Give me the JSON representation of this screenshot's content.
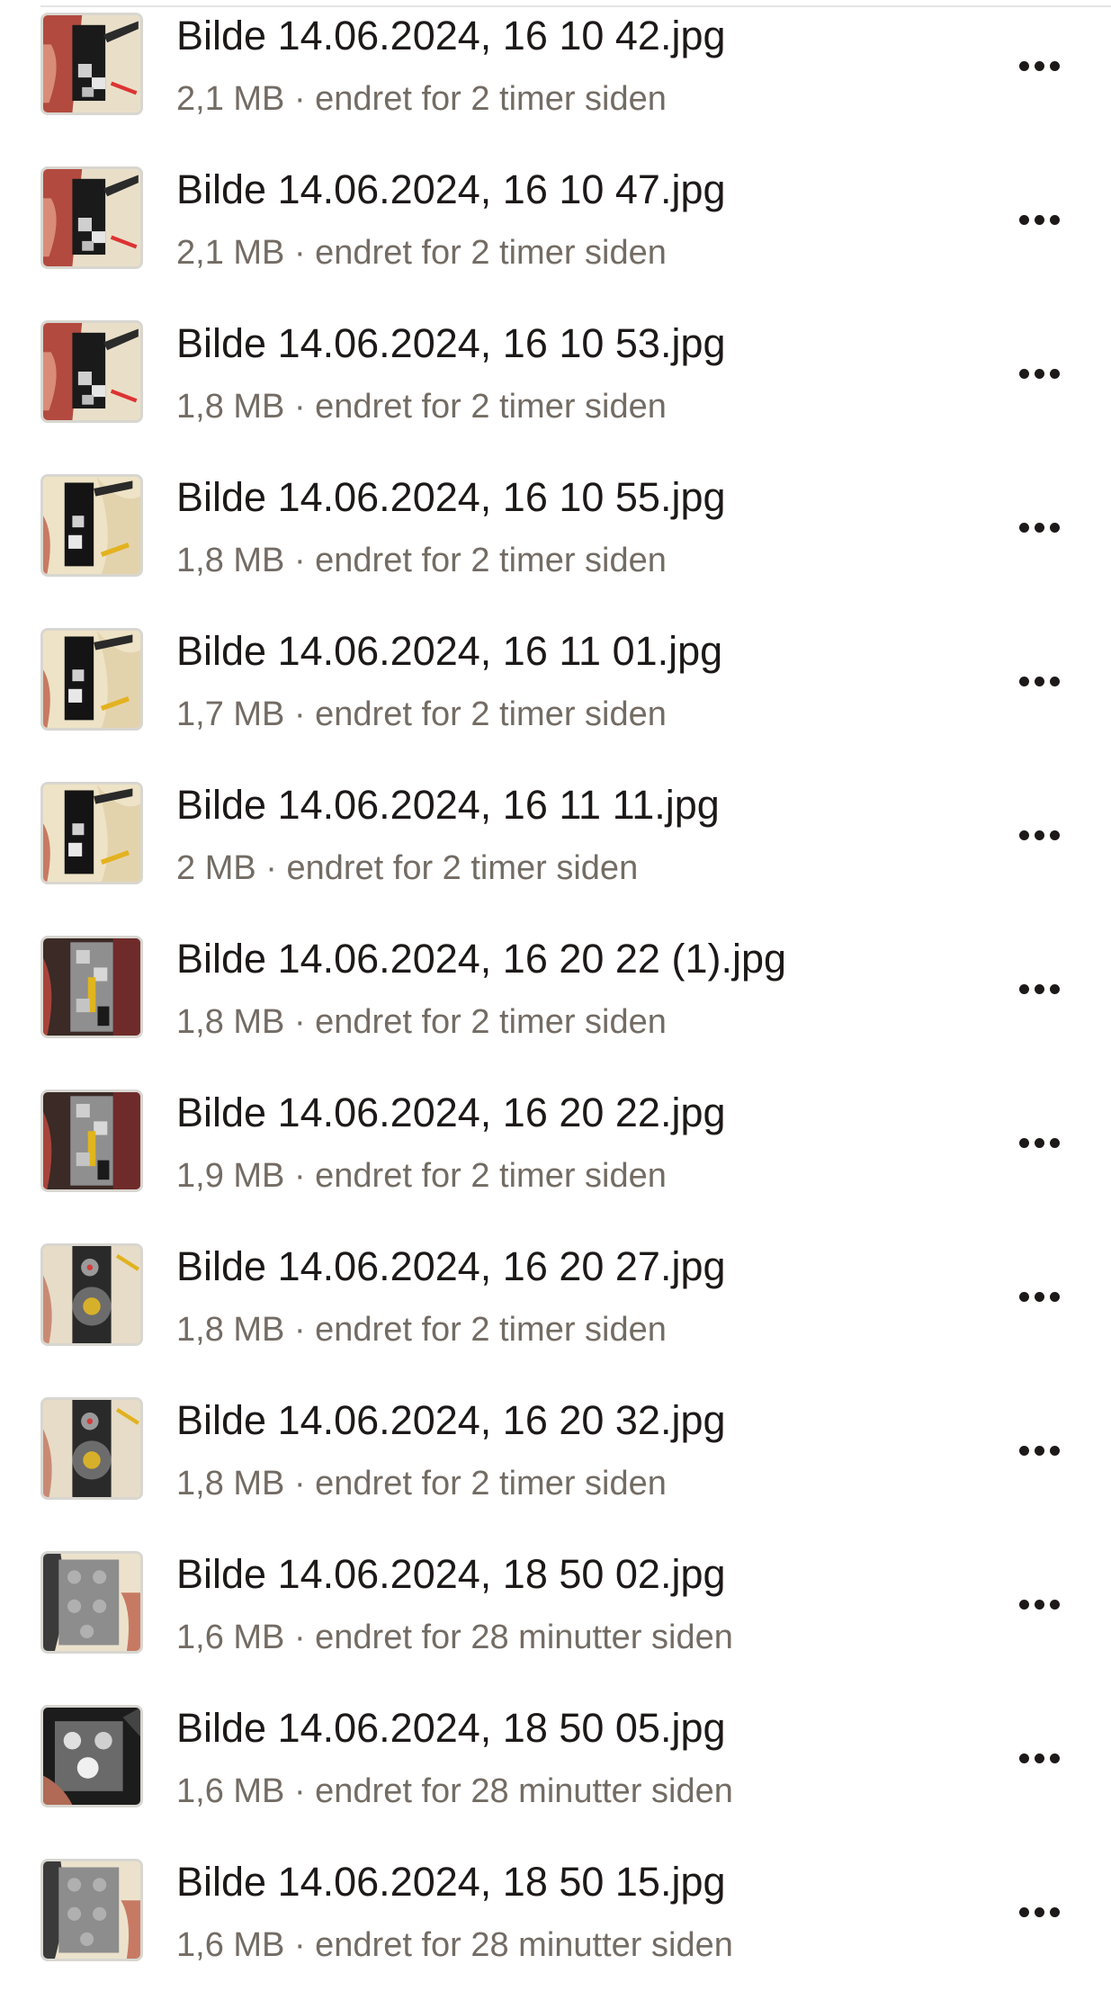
{
  "files": [
    {
      "name": "Bilde 14.06.2024, 16 10 42.jpg",
      "meta": "2,1 MB · endret for 2 timer siden",
      "thumb": "lego-black-red"
    },
    {
      "name": "Bilde 14.06.2024, 16 10 47.jpg",
      "meta": "2,1 MB · endret for 2 timer siden",
      "thumb": "lego-black-red"
    },
    {
      "name": "Bilde 14.06.2024, 16 10 53.jpg",
      "meta": "1,8 MB · endret for 2 timer siden",
      "thumb": "lego-black-red"
    },
    {
      "name": "Bilde 14.06.2024, 16 10 55.jpg",
      "meta": "1,8 MB · endret for 2 timer siden",
      "thumb": "lego-black-cream"
    },
    {
      "name": "Bilde 14.06.2024, 16 11 01.jpg",
      "meta": "1,7 MB · endret for 2 timer siden",
      "thumb": "lego-black-cream"
    },
    {
      "name": "Bilde 14.06.2024, 16 11 11.jpg",
      "meta": "2 MB · endret for 2 timer siden",
      "thumb": "lego-black-cream"
    },
    {
      "name": "Bilde 14.06.2024, 16 20 22 (1).jpg",
      "meta": "1,8 MB · endret for 2 timer siden",
      "thumb": "lego-grey-yellow"
    },
    {
      "name": "Bilde 14.06.2024, 16 20 22.jpg",
      "meta": "1,9 MB · endret for 2 timer siden",
      "thumb": "lego-grey-yellow"
    },
    {
      "name": "Bilde 14.06.2024, 16 20 27.jpg",
      "meta": "1,8 MB · endret for 2 timer siden",
      "thumb": "lego-gear"
    },
    {
      "name": "Bilde 14.06.2024, 16 20 32.jpg",
      "meta": "1,8 MB · endret for 2 timer siden",
      "thumb": "lego-gear"
    },
    {
      "name": "Bilde 14.06.2024, 18 50 02.jpg",
      "meta": "1,6 MB · endret for 28 minutter siden",
      "thumb": "lego-grey"
    },
    {
      "name": "Bilde 14.06.2024, 18 50 05.jpg",
      "meta": "1,6 MB · endret for 28 minutter siden",
      "thumb": "lego-grey-dark"
    },
    {
      "name": "Bilde 14.06.2024, 18 50 15.jpg",
      "meta": "1,6 MB · endret for 28 minutter siden",
      "thumb": "lego-grey"
    }
  ],
  "row_actions": {
    "icon": "more-horizontal-icon"
  },
  "colors": {
    "text_primary": "#1e1919",
    "text_secondary": "#736c64",
    "thumb_border": "#d8d6d0"
  }
}
